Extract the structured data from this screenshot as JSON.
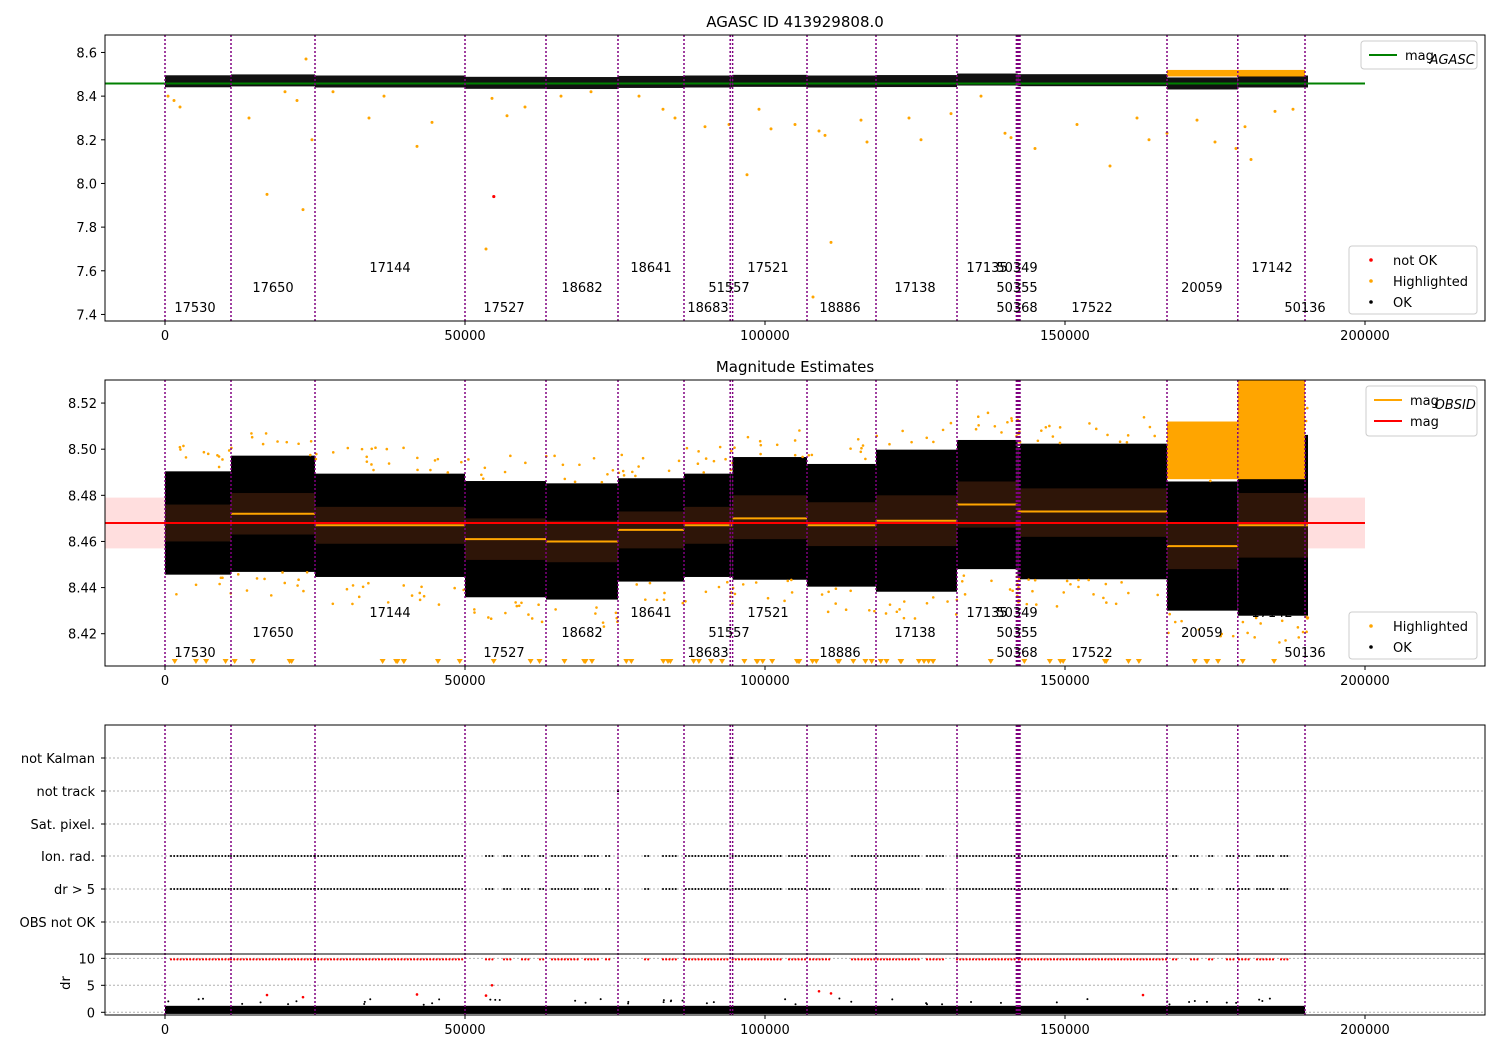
{
  "chart_data": [
    {
      "type": "scatter",
      "title": "AGASC ID 413929808.0",
      "xlim": [
        -10000,
        220000
      ],
      "ylim": [
        7.37,
        8.68
      ],
      "x_ticks": [
        0,
        50000,
        100000,
        150000,
        200000
      ],
      "x_tick_labels": [
        "0",
        "50000",
        "100000",
        "150000",
        "200000"
      ],
      "y_ticks": [
        7.4,
        7.6,
        7.8,
        8.0,
        8.2,
        8.4,
        8.6
      ],
      "y_tick_labels": [
        "7.4",
        "7.6",
        "7.8",
        "8.0",
        "8.2",
        "8.4",
        "8.6"
      ],
      "hlines": [
        {
          "name": "mag_AGASC",
          "y": 8.458,
          "x_range": [
            -10000,
            200000
          ],
          "color": "#008000"
        }
      ],
      "legends": [
        {
          "position": "top-right",
          "entries": [
            {
              "label": "mag",
              "sub": "AGASC",
              "kind": "line",
              "color": "#008000"
            }
          ]
        },
        {
          "position": "lower-right",
          "entries": [
            {
              "label": "not OK",
              "kind": "dot",
              "color": "#ff0000"
            },
            {
              "label": "Highlighted",
              "kind": "dot",
              "color": "#ffa500"
            },
            {
              "label": "OK",
              "kind": "dot",
              "color": "#000000"
            }
          ]
        }
      ],
      "outliers": {
        "series": "Highlighted",
        "points": [
          [
            500,
            8.4
          ],
          [
            1500,
            8.38
          ],
          [
            2500,
            8.35
          ],
          [
            14000,
            8.3
          ],
          [
            17000,
            7.95
          ],
          [
            20000,
            8.42
          ],
          [
            22000,
            8.38
          ],
          [
            23000,
            7.88
          ],
          [
            23500,
            8.57
          ],
          [
            24500,
            8.2
          ],
          [
            28000,
            8.42
          ],
          [
            34000,
            8.3
          ],
          [
            36500,
            8.4
          ],
          [
            42000,
            8.17
          ],
          [
            44500,
            8.28
          ],
          [
            53500,
            7.7
          ],
          [
            54500,
            8.39
          ],
          [
            57000,
            8.31
          ],
          [
            60000,
            8.35
          ],
          [
            66000,
            8.4
          ],
          [
            71000,
            8.42
          ],
          [
            79000,
            8.4
          ],
          [
            83000,
            8.34
          ],
          [
            85000,
            8.3
          ],
          [
            90000,
            8.26
          ],
          [
            94000,
            8.27
          ],
          [
            97000,
            8.04
          ],
          [
            99000,
            8.34
          ],
          [
            101000,
            8.25
          ],
          [
            105000,
            8.27
          ],
          [
            108000,
            7.48
          ],
          [
            109000,
            8.24
          ],
          [
            110000,
            8.22
          ],
          [
            111000,
            7.73
          ],
          [
            116000,
            8.29
          ],
          [
            117000,
            8.19
          ],
          [
            124000,
            8.3
          ],
          [
            126000,
            8.2
          ],
          [
            131000,
            8.32
          ],
          [
            136000,
            8.4
          ],
          [
            140000,
            8.23
          ],
          [
            141000,
            8.21
          ],
          [
            145000,
            8.16
          ],
          [
            152000,
            8.27
          ],
          [
            157500,
            8.08
          ],
          [
            162000,
            8.3
          ],
          [
            164000,
            8.2
          ],
          [
            167000,
            8.23
          ],
          [
            172000,
            8.29
          ],
          [
            175000,
            8.19
          ],
          [
            178500,
            8.16
          ],
          [
            180000,
            8.26
          ],
          [
            181000,
            8.11
          ],
          [
            185000,
            8.33
          ],
          [
            188000,
            8.34
          ]
        ]
      },
      "notok_points": [
        [
          54800,
          7.94
        ]
      ]
    },
    {
      "type": "scatter",
      "title": "Magnitude Estimates",
      "xlim": [
        -10000,
        220000
      ],
      "ylim": [
        8.406,
        8.53
      ],
      "x_ticks": [
        0,
        50000,
        100000,
        150000,
        200000
      ],
      "x_tick_labels": [
        "0",
        "50000",
        "100000",
        "150000",
        "200000"
      ],
      "y_ticks": [
        8.42,
        8.44,
        8.46,
        8.48,
        8.5,
        8.52
      ],
      "y_tick_labels": [
        "8.42",
        "8.44",
        "8.46",
        "8.48",
        "8.50",
        "8.52"
      ],
      "mag": {
        "value": 8.468,
        "band": [
          8.457,
          8.479
        ],
        "x_range": [
          -10000,
          200000
        ],
        "color": "#ff0000"
      },
      "mag_obsid": [
        {
          "obsid": "17530",
          "x0": 0,
          "x1": 11000,
          "mean": 8.468,
          "lo": 8.46,
          "hi": 8.476
        },
        {
          "obsid": "17650",
          "x0": 11000,
          "x1": 25000,
          "mean": 8.472,
          "lo": 8.463,
          "hi": 8.481
        },
        {
          "obsid": "17144",
          "x0": 25000,
          "x1": 50000,
          "mean": 8.467,
          "lo": 8.459,
          "hi": 8.475
        },
        {
          "obsid": "17527",
          "x0": 50000,
          "x1": 63500,
          "mean": 8.461,
          "lo": 8.452,
          "hi": 8.47
        },
        {
          "obsid": "18682",
          "x0": 63500,
          "x1": 75500,
          "mean": 8.46,
          "lo": 8.451,
          "hi": 8.469
        },
        {
          "obsid": "18641",
          "x0": 75500,
          "x1": 86500,
          "mean": 8.465,
          "lo": 8.457,
          "hi": 8.473
        },
        {
          "obsid": "18683",
          "x0": 86500,
          "x1": 94200,
          "mean": 8.467,
          "lo": 8.459,
          "hi": 8.475
        },
        {
          "obsid": "51557",
          "x0": 94200,
          "x1": 94600,
          "mean": 8.467,
          "lo": 8.459,
          "hi": 8.475
        },
        {
          "obsid": "17521",
          "x0": 94600,
          "x1": 107000,
          "mean": 8.47,
          "lo": 8.461,
          "hi": 8.48
        },
        {
          "obsid": "18886",
          "x0": 107000,
          "x1": 118500,
          "mean": 8.467,
          "lo": 8.458,
          "hi": 8.477
        },
        {
          "obsid": "17138",
          "x0": 118500,
          "x1": 132000,
          "mean": 8.469,
          "lo": 8.458,
          "hi": 8.48
        },
        {
          "obsid": "17135",
          "x0": 132000,
          "x1": 141900,
          "mean": 8.476,
          "lo": 8.466,
          "hi": 8.486
        },
        {
          "obsid": "50349",
          "x0": 141900,
          "x1": 142100,
          "mean": 8.476,
          "lo": 8.466,
          "hi": 8.486
        },
        {
          "obsid": "50355",
          "x0": 142100,
          "x1": 142300,
          "mean": 8.473,
          "lo": 8.463,
          "hi": 8.483
        },
        {
          "obsid": "50368",
          "x0": 142300,
          "x1": 142500,
          "mean": 8.473,
          "lo": 8.463,
          "hi": 8.483
        },
        {
          "obsid": "17522",
          "x0": 142500,
          "x1": 167000,
          "mean": 8.473,
          "lo": 8.462,
          "hi": 8.483
        },
        {
          "obsid": "20059",
          "x0": 167000,
          "x1": 178800,
          "mean": 8.458,
          "lo": 8.448,
          "hi": 8.468
        },
        {
          "obsid": "17142",
          "x0": 178800,
          "x1": 190000,
          "mean": 8.467,
          "lo": 8.453,
          "hi": 8.481
        },
        {
          "obsid": "50136",
          "x0": 190000,
          "x1": 190500,
          "mean": 8.467,
          "lo": 8.453,
          "hi": 8.481
        }
      ],
      "legends": [
        {
          "position": "top-right",
          "entries": [
            {
              "label": "mag",
              "sub": "OBSID",
              "kind": "line",
              "color": "#ffa500"
            },
            {
              "label": "mag",
              "kind": "line",
              "color": "#ff0000"
            }
          ]
        },
        {
          "position": "lower-right",
          "entries": [
            {
              "label": "Highlighted",
              "kind": "dot",
              "color": "#ffa500"
            },
            {
              "label": "OK",
              "kind": "dot",
              "color": "#000000"
            }
          ]
        }
      ]
    },
    {
      "type": "scatter",
      "xlim": [
        -10000,
        220000
      ],
      "x_ticks": [
        0,
        50000,
        100000,
        150000,
        200000
      ],
      "x_tick_labels": [
        "0",
        "50000",
        "100000",
        "150000",
        "200000"
      ],
      "flag_rows": [
        "not Kalman",
        "not track",
        "Sat. pixel.",
        "Ion. rad.",
        "dr > 5",
        "OBS not OK"
      ],
      "flag_segments": [
        [
          1000,
          11000
        ],
        [
          11000,
          25000
        ],
        [
          25000,
          50000
        ],
        [
          53500,
          55000
        ],
        [
          56500,
          58000
        ],
        [
          59500,
          61000
        ],
        [
          62500,
          63200
        ],
        [
          64500,
          69000
        ],
        [
          70000,
          72500
        ],
        [
          73500,
          74500
        ],
        [
          80000,
          81000
        ],
        [
          83000,
          85500
        ],
        [
          86800,
          94000
        ],
        [
          94600,
          103000
        ],
        [
          104000,
          107000
        ],
        [
          107500,
          111000
        ],
        [
          114500,
          120500
        ],
        [
          120800,
          126000
        ],
        [
          127000,
          130000
        ],
        [
          132000,
          142000
        ],
        [
          142300,
          167000
        ],
        [
          168000,
          169000
        ],
        [
          171000,
          172500
        ],
        [
          174000,
          175000
        ],
        [
          177000,
          178300
        ],
        [
          179000,
          181000
        ],
        [
          182000,
          185000
        ],
        [
          186000,
          187500
        ]
      ],
      "dr_ylim": [
        -0.5,
        10.8
      ],
      "dr_ticks": [
        0,
        5,
        10
      ],
      "dr_tick_labels": [
        "0",
        "5",
        "10"
      ],
      "dr_ylabel": "dr",
      "dr_outliers": [
        [
          17000,
          3.2
        ],
        [
          23000,
          2.8
        ],
        [
          42000,
          3.3
        ],
        [
          53500,
          3.1
        ],
        [
          54500,
          5.0
        ],
        [
          109000,
          3.9
        ],
        [
          111000,
          3.5
        ],
        [
          163000,
          3.2
        ]
      ]
    }
  ],
  "obsids": [
    {
      "x": 5000,
      "row": 0,
      "label": "17530"
    },
    {
      "x": 18000,
      "row": 1,
      "label": "17650"
    },
    {
      "x": 37500,
      "row": 2,
      "label": "17144"
    },
    {
      "x": 56500,
      "row": 0,
      "label": "17527"
    },
    {
      "x": 69500,
      "row": 1,
      "label": "18682"
    },
    {
      "x": 81000,
      "row": 2,
      "label": "18641"
    },
    {
      "x": 90500,
      "row": 0,
      "label": "18683"
    },
    {
      "x": 94000,
      "row": 1,
      "label": "51557"
    },
    {
      "x": 100500,
      "row": 2,
      "label": "17521"
    },
    {
      "x": 112500,
      "row": 0,
      "label": "18886"
    },
    {
      "x": 125000,
      "row": 1,
      "label": "17138"
    },
    {
      "x": 137000,
      "row": 2,
      "label": "17135"
    },
    {
      "x": 142000,
      "row": 2,
      "label": "50349"
    },
    {
      "x": 142000,
      "row": 1,
      "label": "50355"
    },
    {
      "x": 142000,
      "row": 0,
      "label": "50368"
    },
    {
      "x": 154500,
      "row": 0,
      "label": "17522"
    },
    {
      "x": 172800,
      "row": 1,
      "label": "20059"
    },
    {
      "x": 184500,
      "row": 2,
      "label": "17142"
    },
    {
      "x": 190000,
      "row": 0,
      "label": "50136"
    }
  ],
  "obsid_boundaries": [
    0,
    11000,
    25000,
    50000,
    63500,
    75500,
    86500,
    94200,
    94600,
    107000,
    118500,
    132000,
    141900,
    142100,
    142300,
    142500,
    167000,
    178800,
    190000
  ],
  "colors": {
    "ok": "#000000",
    "highlighted": "#ffa500",
    "not_ok": "#ff0000",
    "boundary": "#800080",
    "agasc": "#008000",
    "mag": "#ff0000",
    "mag_obsid": "#ffa500",
    "axis": "#000000"
  }
}
